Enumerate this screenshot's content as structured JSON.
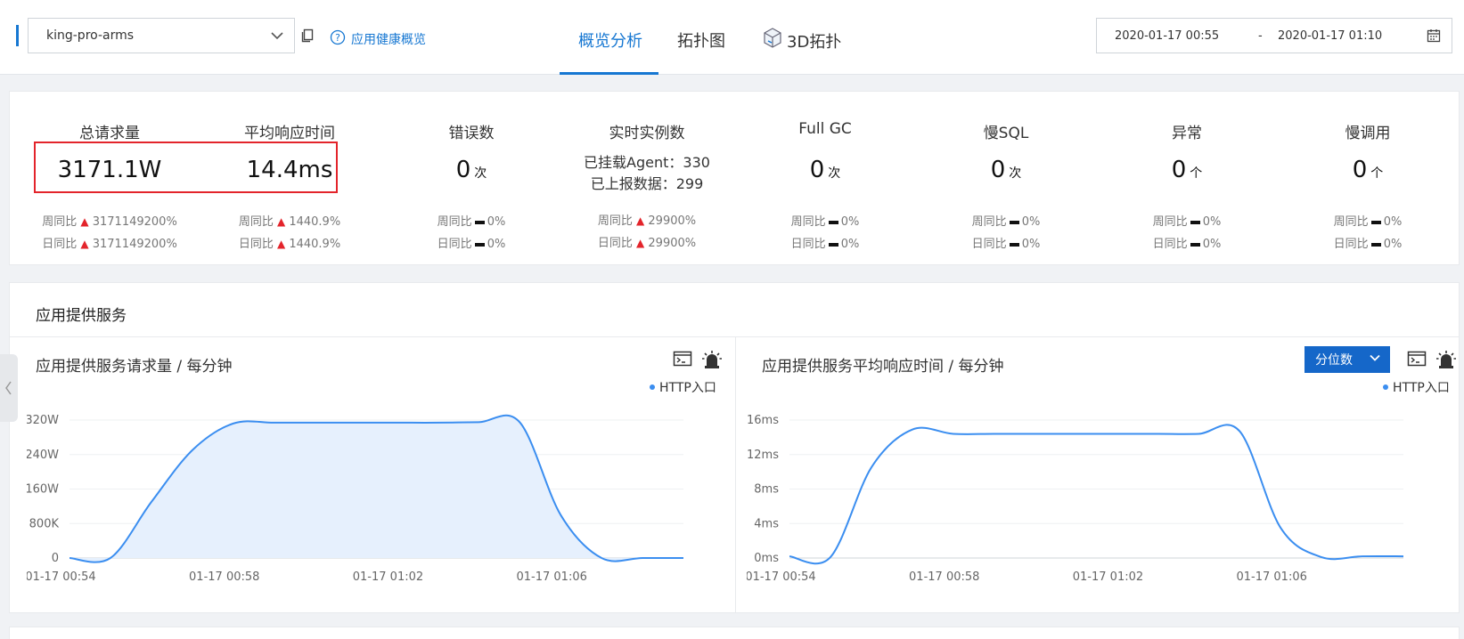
{
  "header": {
    "app_name": "king-pro-arms",
    "health_link": "应用健康概览",
    "tabs": [
      {
        "label": "概览分析",
        "active": true
      },
      {
        "label": "拓扑图",
        "active": false
      },
      {
        "label": "3D拓扑",
        "active": false
      }
    ],
    "date_start": "2020-01-17 00:55",
    "date_sep": "-",
    "date_end": "2020-01-17 01:10",
    "icons": [
      "chevron-down-icon",
      "copy-icon",
      "help-circle-icon",
      "cube-icon",
      "calendar-icon"
    ]
  },
  "stats": [
    {
      "label": "总请求量",
      "value": "3171.1W",
      "unit": "",
      "weekly_label": "周同比",
      "weekly": "3171149200%",
      "weekly_trend": "up",
      "daily_label": "日同比",
      "daily": "3171149200%",
      "daily_trend": "up"
    },
    {
      "label": "平均响应时间",
      "value": "14.4ms",
      "unit": "",
      "weekly_label": "周同比",
      "weekly": "1440.9%",
      "weekly_trend": "up",
      "daily_label": "日同比",
      "daily": "1440.9%",
      "daily_trend": "up"
    },
    {
      "label": "错误数",
      "value": "0",
      "unit": "次",
      "weekly_label": "周同比",
      "weekly": "0%",
      "weekly_trend": "flat",
      "daily_label": "日同比",
      "daily": "0%",
      "daily_trend": "flat"
    },
    {
      "label": "实时实例数",
      "line1": "已挂载Agent：330",
      "line2": "已上报数据：299",
      "weekly_label": "周同比",
      "weekly": "29900%",
      "weekly_trend": "up",
      "daily_label": "日同比",
      "daily": "29900%",
      "daily_trend": "up"
    },
    {
      "label": "Full GC",
      "value": "0",
      "unit": "次",
      "weekly_label": "周同比",
      "weekly": "0%",
      "weekly_trend": "flat",
      "daily_label": "日同比",
      "daily": "0%",
      "daily_trend": "flat"
    },
    {
      "label": "慢SQL",
      "value": "0",
      "unit": "次",
      "weekly_label": "周同比",
      "weekly": "0%",
      "weekly_trend": "flat",
      "daily_label": "日同比",
      "daily": "0%",
      "daily_trend": "flat"
    },
    {
      "label": "异常",
      "value": "0",
      "unit": "个",
      "weekly_label": "周同比",
      "weekly": "0%",
      "weekly_trend": "flat",
      "daily_label": "日同比",
      "daily": "0%",
      "daily_trend": "flat"
    },
    {
      "label": "慢调用",
      "value": "0",
      "unit": "个",
      "weekly_label": "周同比",
      "weekly": "0%",
      "weekly_trend": "flat",
      "daily_label": "日同比",
      "daily": "0%",
      "daily_trend": "flat"
    }
  ],
  "services": {
    "title": "应用提供服务",
    "quantile_button": "分位数",
    "panel_icons": [
      "terminal-icon",
      "alarm-icon"
    ]
  },
  "chart_data": [
    {
      "type": "area",
      "title": "应用提供服务请求量 / 每分钟",
      "legend": [
        "HTTP入口"
      ],
      "legend_position": "top-right",
      "x_ticks": [
        "01-17 00:54",
        "01-17 00:58",
        "01-17 01:02",
        "01-17 01:06"
      ],
      "y_ticks": [
        "0",
        "800K",
        "160W",
        "240W",
        "320W"
      ],
      "ylim": [
        0,
        3200000
      ],
      "grid": true,
      "series": [
        {
          "name": "HTTP入口",
          "color": "#3b8ef0",
          "x": [
            "00:54",
            "00:55",
            "00:56",
            "00:57",
            "00:58",
            "00:59",
            "01:00",
            "01:01",
            "01:02",
            "01:03",
            "01:04",
            "01:05",
            "01:06",
            "01:07",
            "01:08",
            "01:09"
          ],
          "y": [
            0,
            0,
            1300000,
            2500000,
            3120000,
            3140000,
            3140000,
            3140000,
            3140000,
            3140000,
            3150000,
            3150000,
            1000000,
            0,
            0,
            0
          ]
        }
      ]
    },
    {
      "type": "line",
      "title": "应用提供服务平均响应时间 / 每分钟",
      "legend": [
        "HTTP入口"
      ],
      "legend_position": "top-right",
      "x_ticks": [
        "01-17 00:54",
        "01-17 00:58",
        "01-17 01:02",
        "01-17 01:06"
      ],
      "y_ticks": [
        "0ms",
        "4ms",
        "8ms",
        "12ms",
        "16ms"
      ],
      "ylim": [
        0,
        16
      ],
      "grid": true,
      "series": [
        {
          "name": "HTTP入口",
          "color": "#3b8ef0",
          "x": [
            "00:54",
            "00:55",
            "00:56",
            "00:57",
            "00:58",
            "00:59",
            "01:00",
            "01:01",
            "01:02",
            "01:03",
            "01:04",
            "01:05",
            "01:06",
            "01:07",
            "01:08",
            "01:09"
          ],
          "y": [
            0.2,
            0.1,
            10.5,
            14.9,
            14.4,
            14.4,
            14.4,
            14.4,
            14.4,
            14.4,
            14.4,
            14.7,
            3.5,
            0.1,
            0.2,
            0.2
          ]
        }
      ]
    }
  ]
}
